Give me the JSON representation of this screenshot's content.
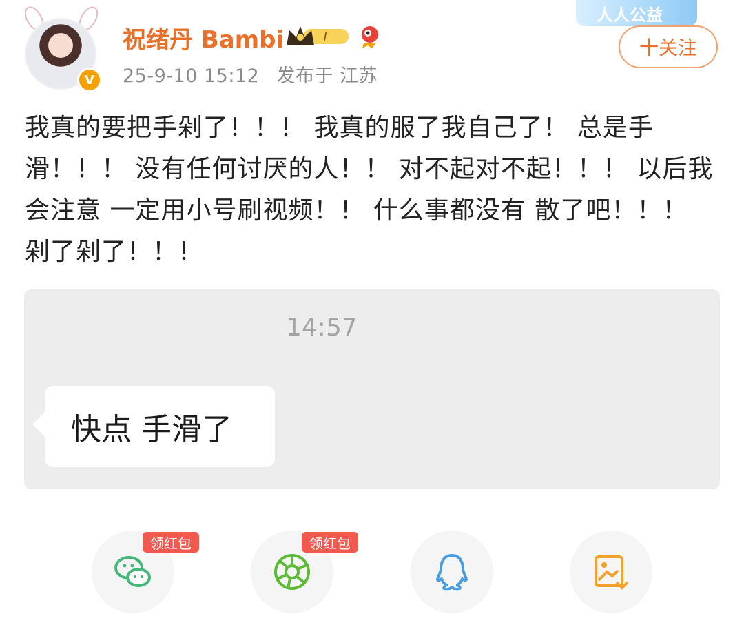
{
  "header": {
    "username": "祝绪丹 Bambi",
    "meta": {
      "date": "25-9-10 15:12",
      "location": "发布于 江苏"
    },
    "charity_label": "人人公益",
    "follow_label": "十关注",
    "verified_badge": "V",
    "level_badge": "I"
  },
  "post": {
    "text": "我真的要把手剁了！！！ 我真的服了我自己了！ 总是手滑！！！ 没有任何讨厌的人！！ 对不起对不起！！！ 以后我会注意 一定用小号刷视频！！ 什么事都没有 散了吧！！！ 剁了剁了！！！"
  },
  "chat": {
    "time": "14:57",
    "message": "快点 手滑了"
  },
  "share": {
    "items": [
      {
        "icon": "wechat-icon",
        "tag": "领红包",
        "color": "#44b97a"
      },
      {
        "icon": "moments-icon",
        "tag": "领红包",
        "color": "#5dbb38"
      },
      {
        "icon": "qq-icon",
        "tag": "",
        "color": "#4b9cdf"
      },
      {
        "icon": "save-image-icon",
        "tag": "",
        "color": "#f2a12d"
      }
    ]
  },
  "colors": {
    "accent": "#e8702a",
    "tag_red": "#f25a4f",
    "chat_bg": "#ededed"
  }
}
